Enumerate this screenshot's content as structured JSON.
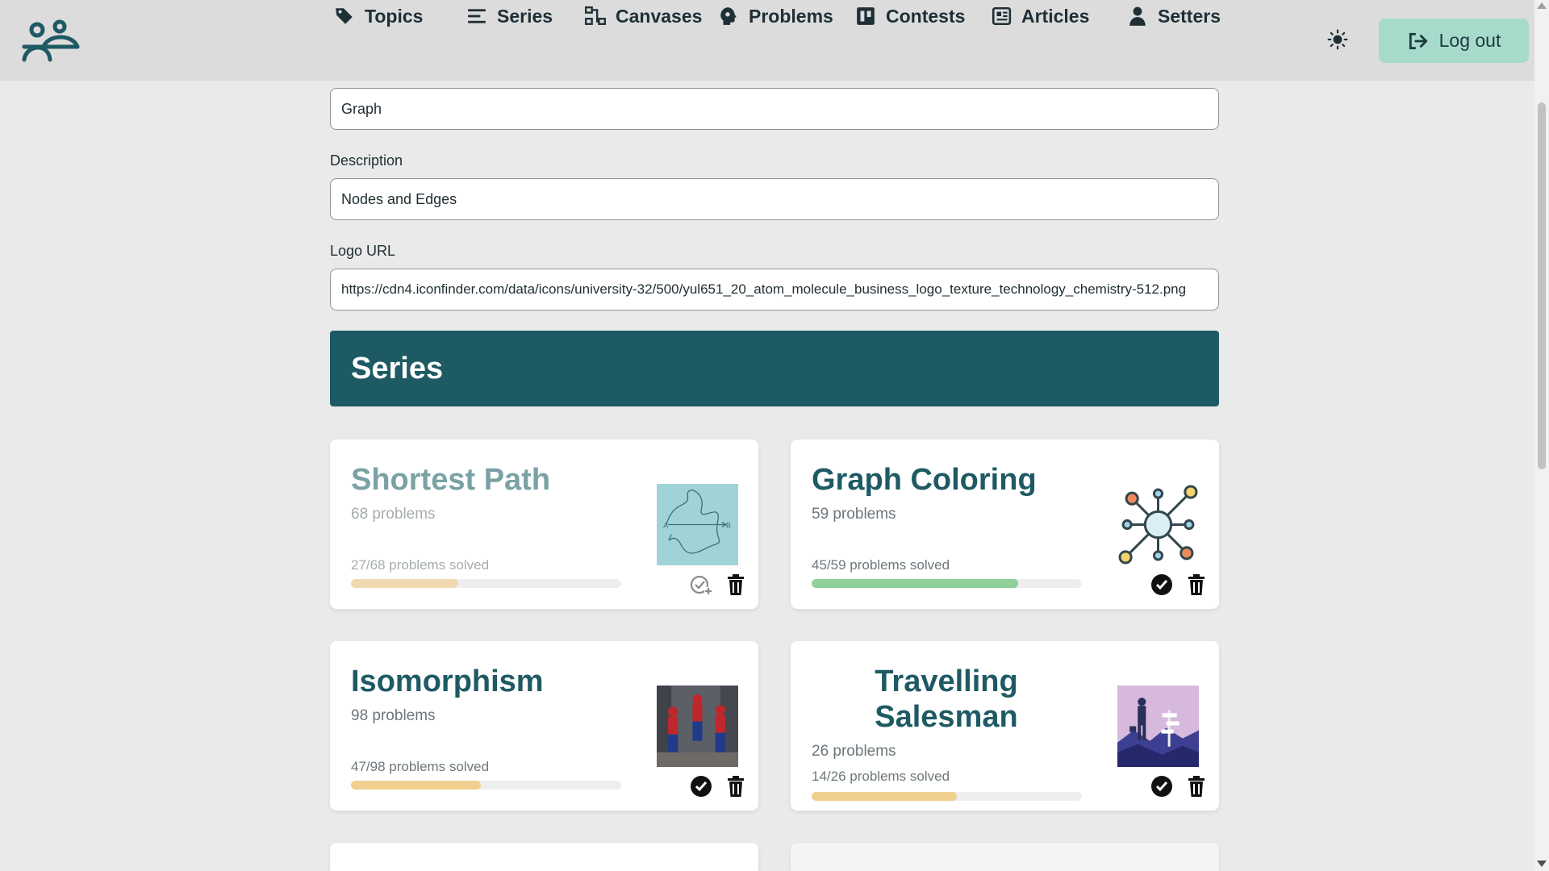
{
  "header": {
    "nav": [
      {
        "label": "Topics",
        "icon": "tags-icon"
      },
      {
        "label": "Series",
        "icon": "list-icon"
      },
      {
        "label": "Canvases",
        "icon": "diagram-icon"
      },
      {
        "label": "Problems",
        "icon": "brain-icon"
      },
      {
        "label": "Contests",
        "icon": "board-icon"
      },
      {
        "label": "Articles",
        "icon": "newspaper-icon"
      },
      {
        "label": "Setters",
        "icon": "user-icon"
      }
    ],
    "logout_label": "Log out"
  },
  "form": {
    "name_value": "Graph",
    "description_label": "Description",
    "description_value": "Nodes and Edges",
    "logo_label": "Logo URL",
    "logo_value": "https://cdn4.iconfinder.com/data/icons/university-32/500/yul651_20_atom_molecule_business_logo_texture_technology_chemistry-512.png"
  },
  "series_section": {
    "heading": "Series",
    "cards": [
      {
        "title": "Shortest Path",
        "count": "68 problems",
        "solved_text": "27/68 problems solved",
        "progress": 0.397,
        "bar_color": "#f0d9b0",
        "state": "faded",
        "thumb": "shortest-path-thumbnail"
      },
      {
        "title": "Graph Coloring",
        "count": "59 problems",
        "solved_text": "45/59 problems solved",
        "progress": 0.763,
        "bar_color": "#8fcf9a",
        "state": "normal",
        "thumb": "graph-network-thumbnail"
      },
      {
        "title": "Isomorphism",
        "count": "98 problems",
        "solved_text": "47/98 problems solved",
        "progress": 0.48,
        "bar_color": "#f1cf8e",
        "state": "normal",
        "thumb": "spiderman-thumbnail"
      },
      {
        "title_line1": "Travelling",
        "title_line2": "Salesman",
        "count": "26 problems",
        "solved_text": "14/26 problems solved",
        "progress": 0.538,
        "bar_color": "#f1cf8e",
        "state": "normal",
        "thumb": "salesman-thumbnail"
      }
    ]
  },
  "colors": {
    "accent": "#1e5a63",
    "logout_bg": "#a6dbcc"
  }
}
